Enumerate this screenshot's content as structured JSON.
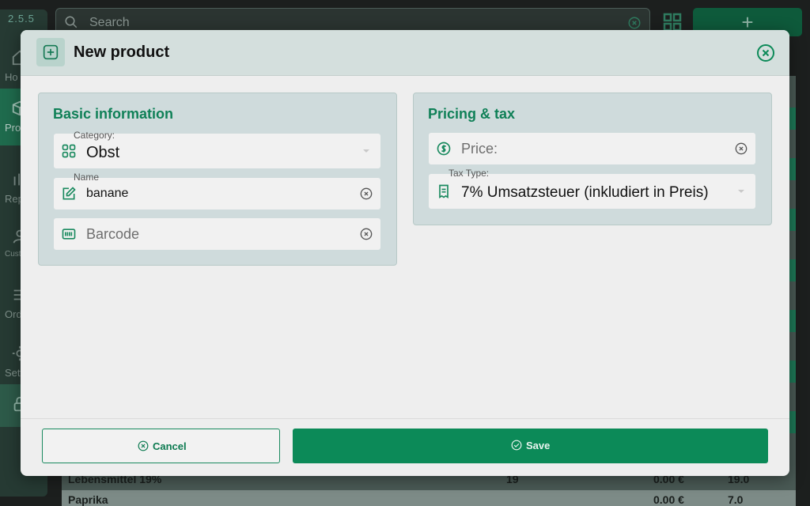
{
  "app": {
    "version": "2.5.5",
    "sidebar": {
      "items": [
        {
          "label": "Ho",
          "icon": "home-icon"
        },
        {
          "label": "Pro",
          "icon": "box-icon"
        },
        {
          "label": "Rep",
          "icon": "chart-icon"
        },
        {
          "label": "Custo",
          "icon": "person-icon"
        },
        {
          "label": "Ord",
          "icon": "list-icon"
        },
        {
          "label": "Sett",
          "icon": "gear-icon"
        },
        {
          "label": "",
          "icon": "lock-icon"
        }
      ]
    },
    "search": {
      "placeholder": "Search"
    },
    "add_label": "+",
    "table_rows": [
      {
        "name": "Lebensmittel 19%",
        "tax": "19",
        "price": "0.00 €",
        "stock": "19.0"
      },
      {
        "name": "Paprika",
        "tax": "",
        "price": "0.00 €",
        "stock": "7.0"
      }
    ]
  },
  "modal": {
    "title": "New product",
    "basic": {
      "title": "Basic information",
      "category": {
        "label": "Category:",
        "value": "Obst"
      },
      "name": {
        "label": "Name",
        "value": "banane"
      },
      "barcode": {
        "placeholder": "Barcode"
      }
    },
    "pricing": {
      "title": "Pricing & tax",
      "price": {
        "placeholder": "Price:"
      },
      "tax": {
        "label": "Tax Type:",
        "value": "7% Umsatzsteuer (inkludiert in Preis)"
      }
    },
    "cancel_label": "Cancel",
    "save_label": "Save"
  },
  "colors": {
    "accent": "#0c8a58",
    "section_title": "#0f8057",
    "section_bg": "#cfdbdc"
  }
}
